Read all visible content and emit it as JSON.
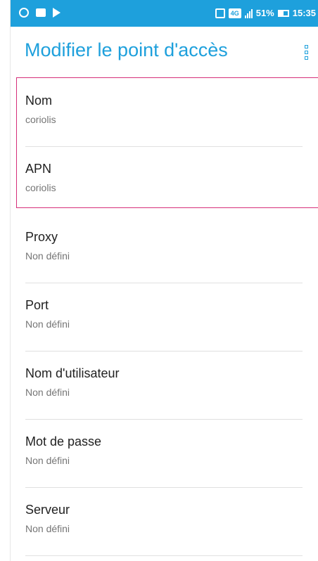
{
  "status_bar": {
    "network": "4G",
    "battery": "51%",
    "time": "15:35"
  },
  "app_bar": {
    "title": "Modifier le point d'accès",
    "more_icon": "more-vert-icon"
  },
  "fields": [
    {
      "label": "Nom",
      "value": "coriolis"
    },
    {
      "label": "APN",
      "value": "coriolis"
    },
    {
      "label": "Proxy",
      "value": "Non défini"
    },
    {
      "label": "Port",
      "value": "Non défini"
    },
    {
      "label": "Nom d'utilisateur",
      "value": "Non défini"
    },
    {
      "label": "Mot de passe",
      "value": "Non défini"
    },
    {
      "label": "Serveur",
      "value": "Non défini"
    }
  ],
  "colors": {
    "accent": "#1ea0dc",
    "highlight": "#d6307a"
  }
}
